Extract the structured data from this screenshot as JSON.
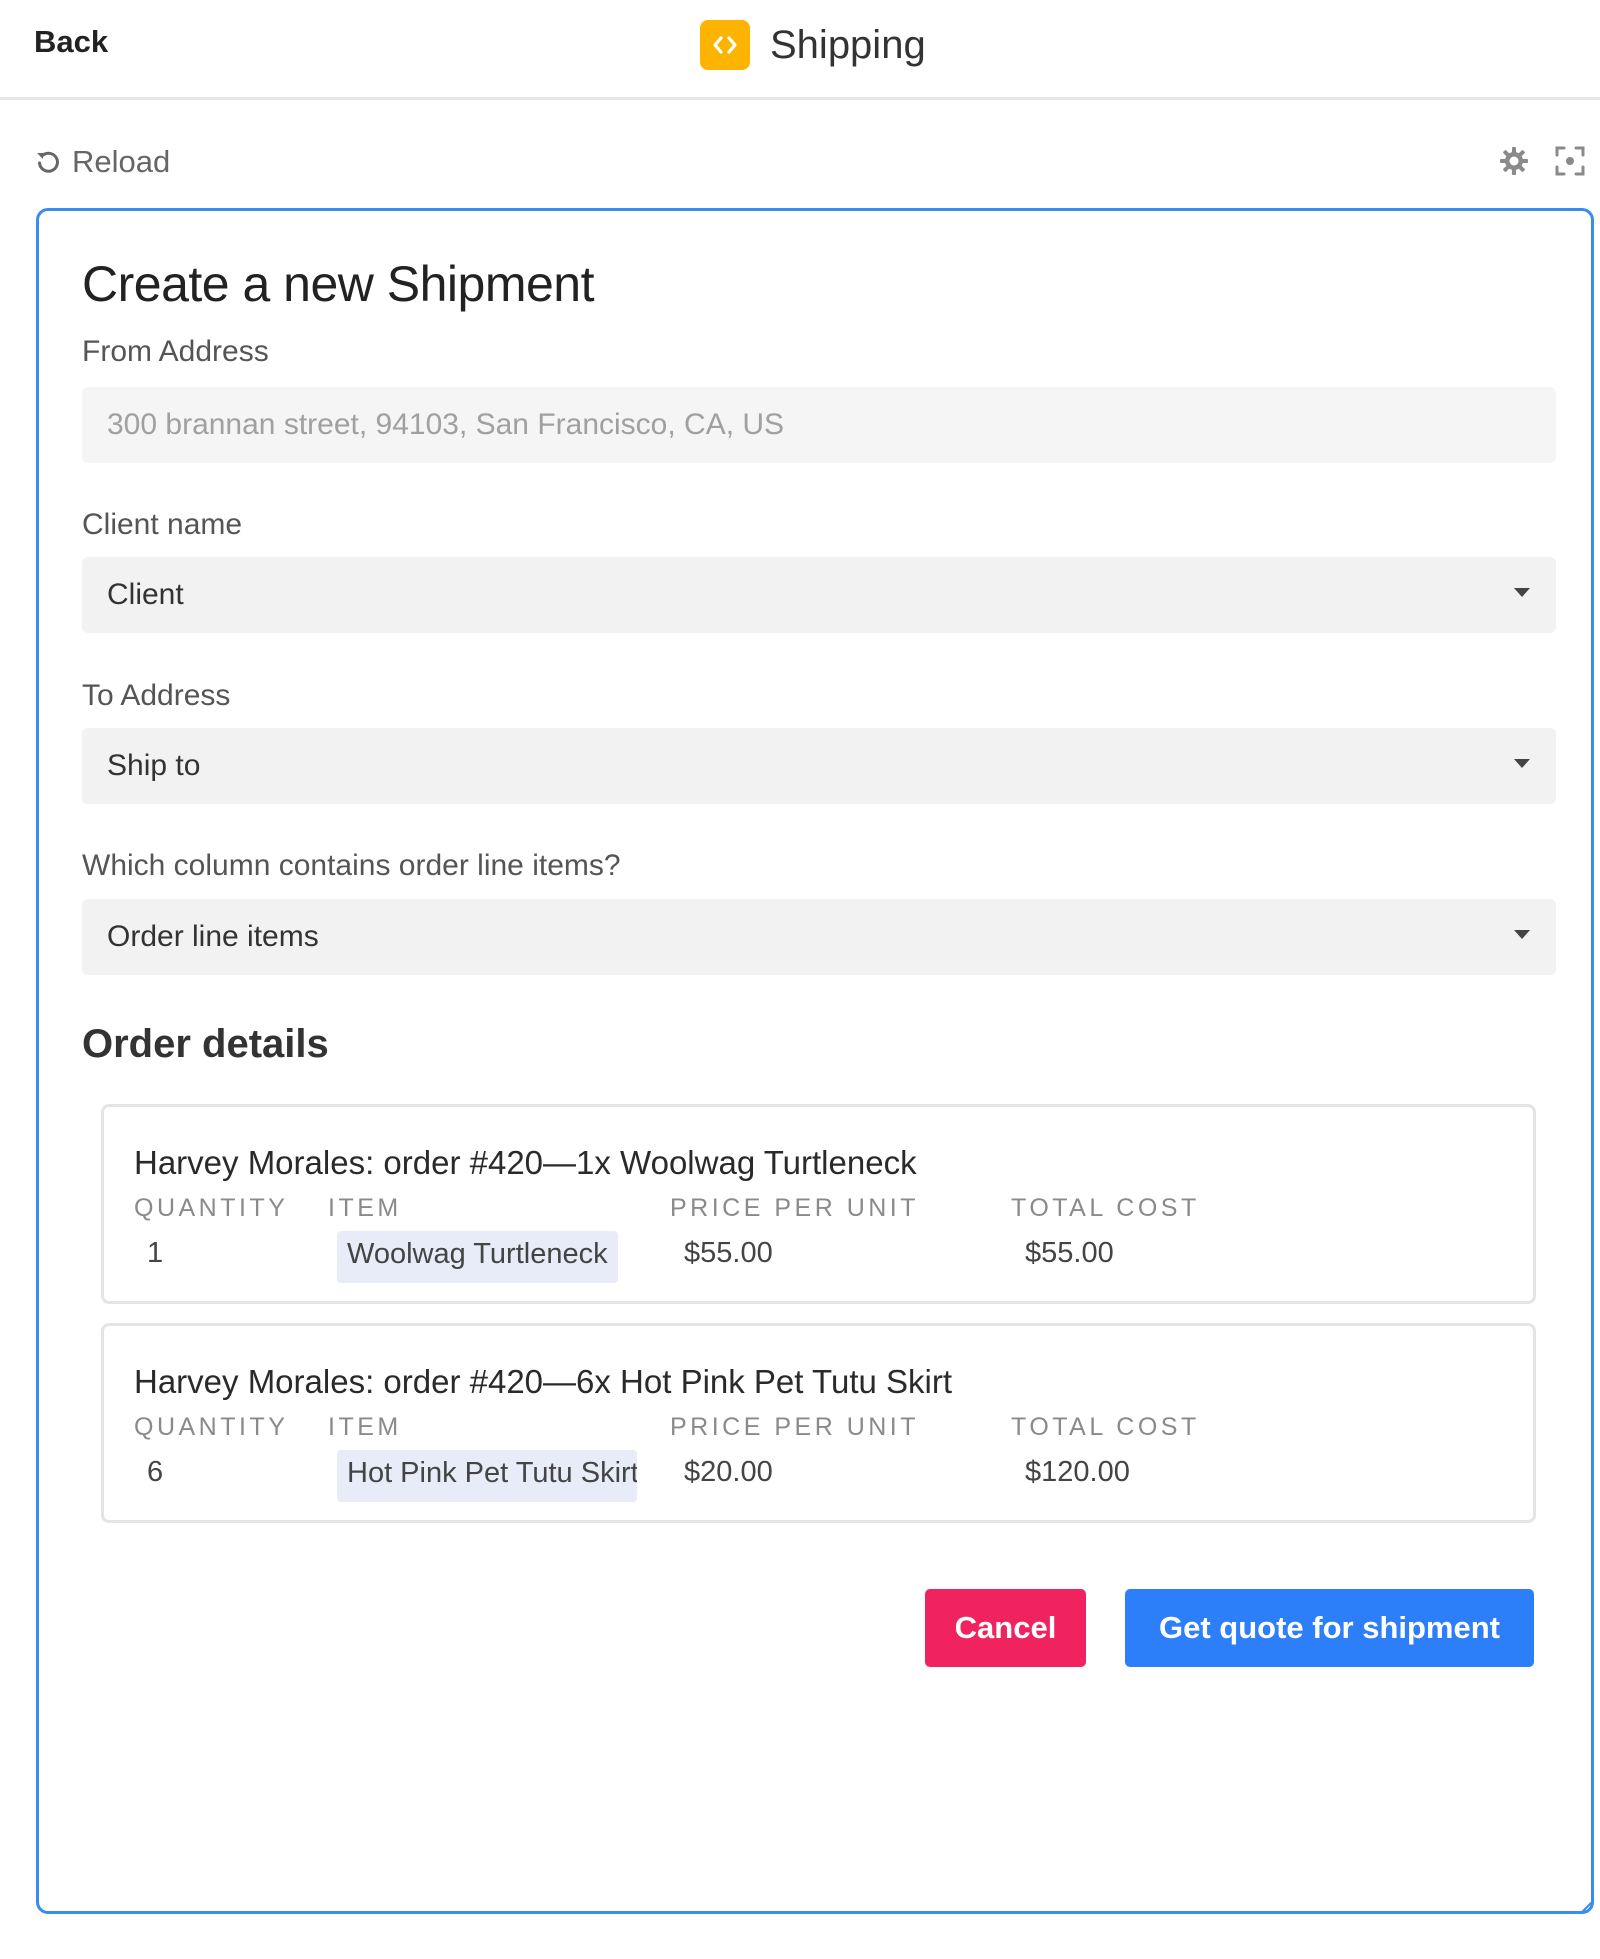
{
  "topbar": {
    "back_label": "Back",
    "app_title": "Shipping",
    "app_icon": "code-brackets-icon",
    "app_icon_color": "#fcb400"
  },
  "toolbar": {
    "reload_label": "Reload",
    "settings_icon": "gear-icon",
    "fullscreen_icon": "expand-icon"
  },
  "form": {
    "title": "Create a new Shipment",
    "from_address": {
      "label": "From Address",
      "placeholder": "300 brannan street, 94103, San Francisco, CA, US"
    },
    "client_name": {
      "label": "Client name",
      "value": "Client"
    },
    "to_address": {
      "label": "To Address",
      "value": "Ship to"
    },
    "line_items_column": {
      "label": "Which column contains order line items?",
      "value": "Order line items"
    }
  },
  "order_details": {
    "title": "Order details",
    "columns": {
      "quantity": "Quantity",
      "item": "Item",
      "price_per_unit": "Price per unit",
      "total_cost": "Total cost"
    },
    "orders": [
      {
        "title": "Harvey Morales: order #420—1x Woolwag Turtleneck",
        "quantity": "1",
        "item": "Woolwag Turtleneck",
        "price_per_unit": "$55.00",
        "total_cost": "$55.00"
      },
      {
        "title": "Harvey Morales: order #420—6x Hot Pink Pet Tutu Skirt",
        "quantity": "6",
        "item": "Hot Pink Pet Tutu Skirt",
        "price_per_unit": "$20.00",
        "total_cost": "$120.00"
      }
    ]
  },
  "actions": {
    "cancel_label": "Cancel",
    "quote_label": "Get quote for shipment",
    "cancel_color": "#f0235f",
    "quote_color": "#2d7ff9"
  },
  "theme": {
    "accent": "#3b8cf0"
  }
}
